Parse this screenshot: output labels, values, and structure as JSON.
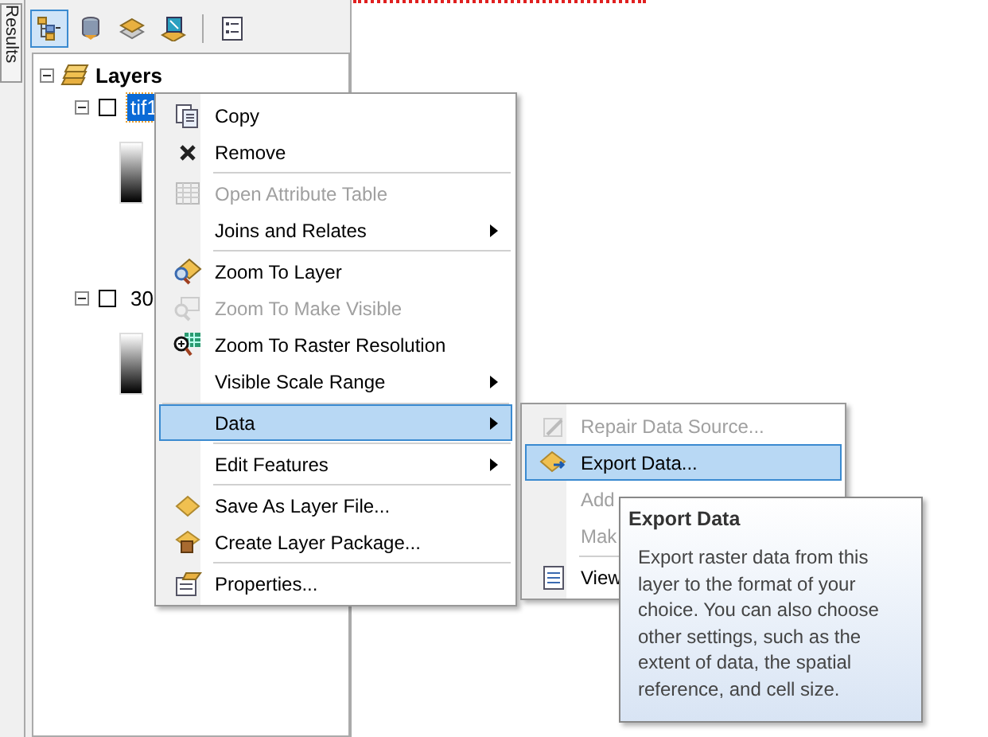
{
  "side_tab": {
    "label": "Results"
  },
  "toolbar": [
    {
      "kind": "drawing-order",
      "selected": true
    },
    {
      "kind": "source",
      "selected": false
    },
    {
      "kind": "visibility",
      "selected": false
    },
    {
      "kind": "selection",
      "selected": false
    },
    {
      "kind": "options",
      "selected": false
    }
  ],
  "toc": {
    "label": "Layers",
    "expanded": true,
    "layers": [
      {
        "label": "tif1",
        "selected": true,
        "checked": false,
        "expanded": true
      },
      {
        "label": "30",
        "selected": false,
        "checked": false,
        "expanded": true
      }
    ]
  },
  "context_menu": {
    "items": [
      {
        "label": "Copy",
        "kind": "copy",
        "disabled": false,
        "has_submenu": false,
        "highlighted": false,
        "separator_before": false
      },
      {
        "label": "Remove",
        "kind": "remove",
        "disabled": false,
        "has_submenu": false,
        "highlighted": false,
        "separator_before": false
      },
      {
        "label": "Open Attribute Table",
        "kind": "table",
        "disabled": true,
        "has_submenu": false,
        "highlighted": false,
        "separator_before": true
      },
      {
        "label": "Joins and Relates",
        "kind": "none",
        "disabled": false,
        "has_submenu": true,
        "highlighted": false,
        "separator_before": false
      },
      {
        "label": "Zoom To Layer",
        "kind": "zoom-layer",
        "disabled": false,
        "has_submenu": false,
        "highlighted": false,
        "separator_before": true
      },
      {
        "label": "Zoom To Make Visible",
        "kind": "zoom-visible",
        "disabled": true,
        "has_submenu": false,
        "highlighted": false,
        "separator_before": false
      },
      {
        "label": "Zoom To Raster Resolution",
        "kind": "zoom-raster",
        "disabled": false,
        "has_submenu": false,
        "highlighted": false,
        "separator_before": false
      },
      {
        "label": "Visible Scale Range",
        "kind": "none",
        "disabled": false,
        "has_submenu": true,
        "highlighted": false,
        "separator_before": false
      },
      {
        "label": "Data",
        "kind": "none",
        "disabled": false,
        "has_submenu": true,
        "highlighted": true,
        "separator_before": true
      },
      {
        "label": "Edit Features",
        "kind": "none",
        "disabled": false,
        "has_submenu": true,
        "highlighted": false,
        "separator_before": true
      },
      {
        "label": "Save As Layer File...",
        "kind": "layer-file",
        "disabled": false,
        "has_submenu": false,
        "highlighted": false,
        "separator_before": true
      },
      {
        "label": "Create Layer Package...",
        "kind": "layer-package",
        "disabled": false,
        "has_submenu": false,
        "highlighted": false,
        "separator_before": false
      },
      {
        "label": "Properties...",
        "kind": "properties",
        "disabled": false,
        "has_submenu": false,
        "highlighted": false,
        "separator_before": true
      }
    ]
  },
  "submenu": {
    "items": [
      {
        "label": "Repair Data Source...",
        "kind": "repair",
        "disabled": true,
        "highlighted": false,
        "separator_before": false
      },
      {
        "label": "Export Data...",
        "kind": "export",
        "disabled": false,
        "highlighted": true,
        "separator_before": false
      },
      {
        "label": "Add",
        "kind": "none",
        "disabled": true,
        "highlighted": false,
        "separator_before": false
      },
      {
        "label": "Mak",
        "kind": "none",
        "disabled": true,
        "highlighted": false,
        "separator_before": false
      },
      {
        "label": "View",
        "kind": "view",
        "disabled": false,
        "highlighted": false,
        "separator_before": true
      }
    ]
  },
  "tooltip": {
    "title": "Export Data",
    "text": "Export raster data from this layer to the format of your choice. You can also choose other settings, such as the extent of data, the spatial reference, and cell size."
  }
}
